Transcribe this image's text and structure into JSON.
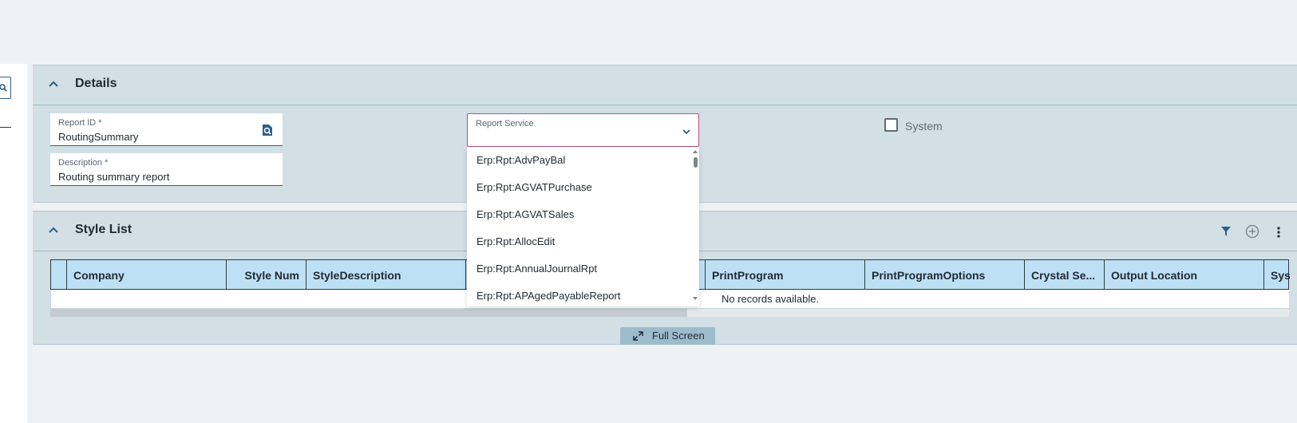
{
  "details": {
    "title": "Details",
    "report_id": {
      "label": "Report ID *",
      "value": "RoutingSummary"
    },
    "description": {
      "label": "Description *",
      "value": "Routing summary report"
    },
    "report_service": {
      "label": "Report Service",
      "value": "",
      "options": [
        "Erp:Rpt:AdvPayBal",
        "Erp:Rpt:AGVATPurchase",
        "Erp:Rpt:AGVATSales",
        "Erp:Rpt:AllocEdit",
        "Erp:Rpt:AnnualJournalRpt",
        "Erp:Rpt:APAgedPayableReport"
      ]
    },
    "system": {
      "label": "System",
      "checked": false
    }
  },
  "style_list": {
    "title": "Style List",
    "columns": [
      "Company",
      "Style Num",
      "StyleDescription",
      "",
      "PrintProgram",
      "PrintProgramOptions",
      "Crystal Se...",
      "Output Location",
      "Sys"
    ],
    "empty_text": "No records available.",
    "fullscreen_label": "Full Screen"
  },
  "icons": {
    "collapse": "chevron-up-icon",
    "lookup": "search-document-icon",
    "dropdown": "chevron-down-icon",
    "filter": "filter-icon",
    "add": "add-circle-icon",
    "more": "more-vertical-icon",
    "expand": "expand-icon"
  },
  "colors": {
    "accent": "#2d5f86",
    "panel_bg": "#d2dfe5",
    "header_bg": "#bee0f5",
    "focus_border": "#b9527e"
  }
}
